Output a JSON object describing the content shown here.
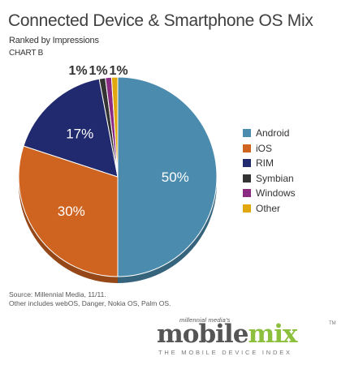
{
  "header": {
    "title": "Connected Device & Smartphone OS Mix",
    "subtitle": "Ranked by Impressions",
    "chart_label": "CHART B"
  },
  "chart_data": {
    "type": "pie",
    "title": "Connected Device & Smartphone OS Mix",
    "subtitle": "Ranked by Impressions",
    "slices": [
      {
        "label": "Android",
        "value": 50,
        "display": "50%",
        "color": "#4b8bae"
      },
      {
        "label": "iOS",
        "value": 30,
        "display": "30%",
        "color": "#cf6320"
      },
      {
        "label": "RIM",
        "value": 17,
        "display": "17%",
        "color": "#212a6e"
      },
      {
        "label": "Symbian",
        "value": 1,
        "display": "",
        "color": "#333333"
      },
      {
        "label": "Windows",
        "value": 1,
        "display": "1%",
        "color": "#8a2a82"
      },
      {
        "label": "Other",
        "value": 1,
        "display": "1%",
        "color": "#e0a80e"
      }
    ],
    "top_labels": [
      "1%",
      "1%",
      "1%"
    ],
    "legend_position": "right"
  },
  "legend": {
    "items": [
      {
        "label": "Android",
        "color": "#4b8bae"
      },
      {
        "label": "iOS",
        "color": "#cf6320"
      },
      {
        "label": "RIM",
        "color": "#212a6e"
      },
      {
        "label": "Symbian",
        "color": "#333333"
      },
      {
        "label": "Windows",
        "color": "#8a2a82"
      },
      {
        "label": "Other",
        "color": "#e0a80e"
      }
    ]
  },
  "footnote": {
    "line1": "Source: Millennial Media, 11/11.",
    "line2": "Other includes webOS, Danger, Nokia OS, Palm OS."
  },
  "brand": {
    "small": "millennial media's",
    "mobile": "mobile",
    "mix": "mix",
    "tm": "TM",
    "tagline": "THE MOBILE DEVICE INDEX"
  }
}
